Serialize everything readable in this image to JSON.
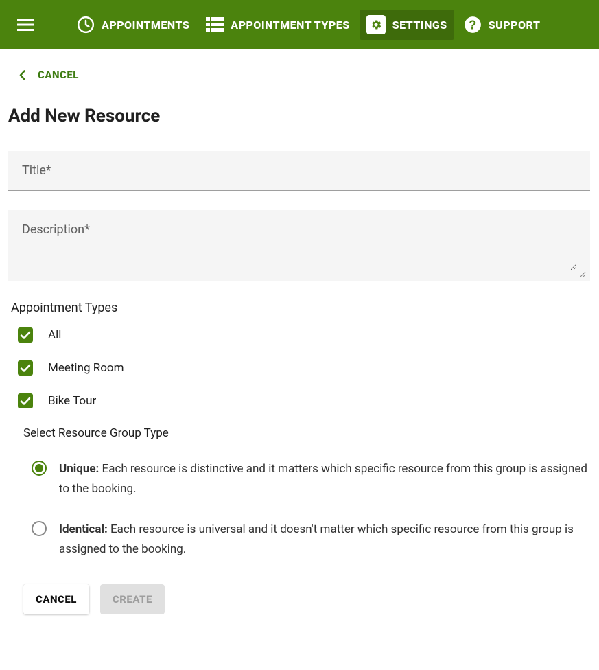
{
  "nav": {
    "appointments": "APPOINTMENTS",
    "appointment_types": "APPOINTMENT TYPES",
    "settings": "SETTINGS",
    "support": "SUPPORT"
  },
  "back_label": "CANCEL",
  "page_title": "Add New Resource",
  "fields": {
    "title_placeholder": "Title*",
    "description_placeholder": "Description*"
  },
  "appt_types_label": "Appointment Types",
  "checkboxes": {
    "all": "All",
    "meeting_room": "Meeting Room",
    "bike_tour": "Bike Tour"
  },
  "group_type_label": "Select Resource Group Type",
  "radios": {
    "unique_title": "Unique:",
    "unique_desc": " Each resource is distinctive and it matters which specific resource from this group is assigned to the booking.",
    "identical_title": "Identical:",
    "identical_desc": " Each resource is universal and it doesn't matter which specific resource from this group is assigned to the booking."
  },
  "buttons": {
    "cancel": "CANCEL",
    "create": "CREATE"
  }
}
